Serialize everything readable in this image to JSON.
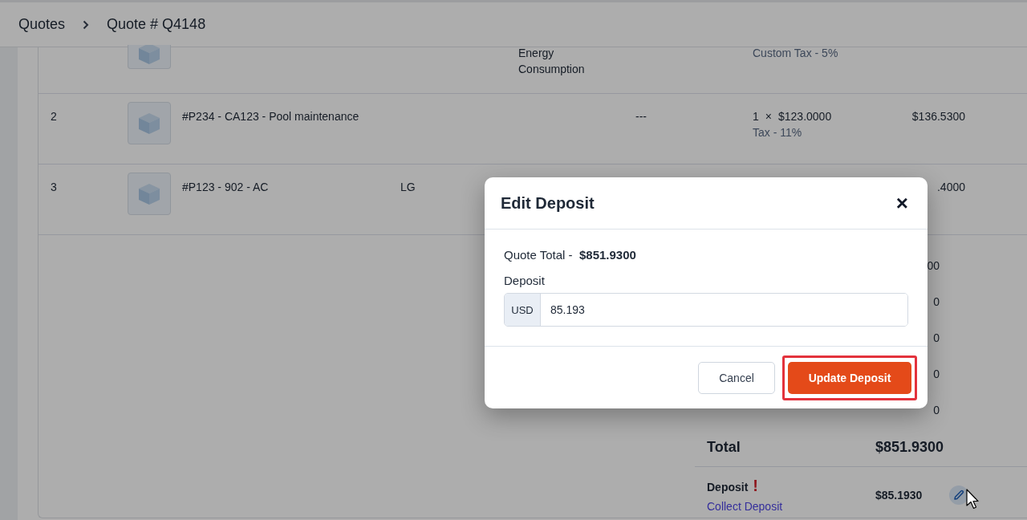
{
  "breadcrumb": [
    {
      "label": "Quotes"
    },
    {
      "label": "Quote # Q4148"
    }
  ],
  "line_items": [
    {
      "column_4": "Energy Consumption",
      "tax": "Custom Tax - 5%",
      "thumb_cut": true
    },
    {
      "number": "2",
      "product": "#P234 - CA123 - Pool maintenance",
      "column_5": "---",
      "quantity": "1",
      "times": "×",
      "unit_price": "$123.0000",
      "tax": "Tax - 11%",
      "amount": "$136.5300",
      "thumb_cut": false
    },
    {
      "number": "3",
      "product": "#P123 - 902 - AC",
      "brand": "LG",
      "amount": ".4000",
      "thumb_cut": false
    }
  ],
  "summary_values": [
    "00",
    "0",
    "0",
    "0",
    "0"
  ],
  "total": {
    "label": "Total",
    "value": "$851.9300"
  },
  "deposit": {
    "label": "Deposit",
    "alert": "!",
    "link": "Collect Deposit",
    "value": "$85.1930"
  },
  "dialog": {
    "title": "Edit Deposit",
    "close": "×",
    "quote_total_label": "Quote Total -",
    "quote_total_value": "$851.9300",
    "deposit_label": "Deposit",
    "currency": "USD",
    "deposit_value": "85.193",
    "buttons": [
      {
        "label": "Cancel",
        "kind": "secondary",
        "highlighted": false
      },
      {
        "label": "Update Deposit",
        "kind": "primary",
        "highlighted": true
      }
    ]
  }
}
